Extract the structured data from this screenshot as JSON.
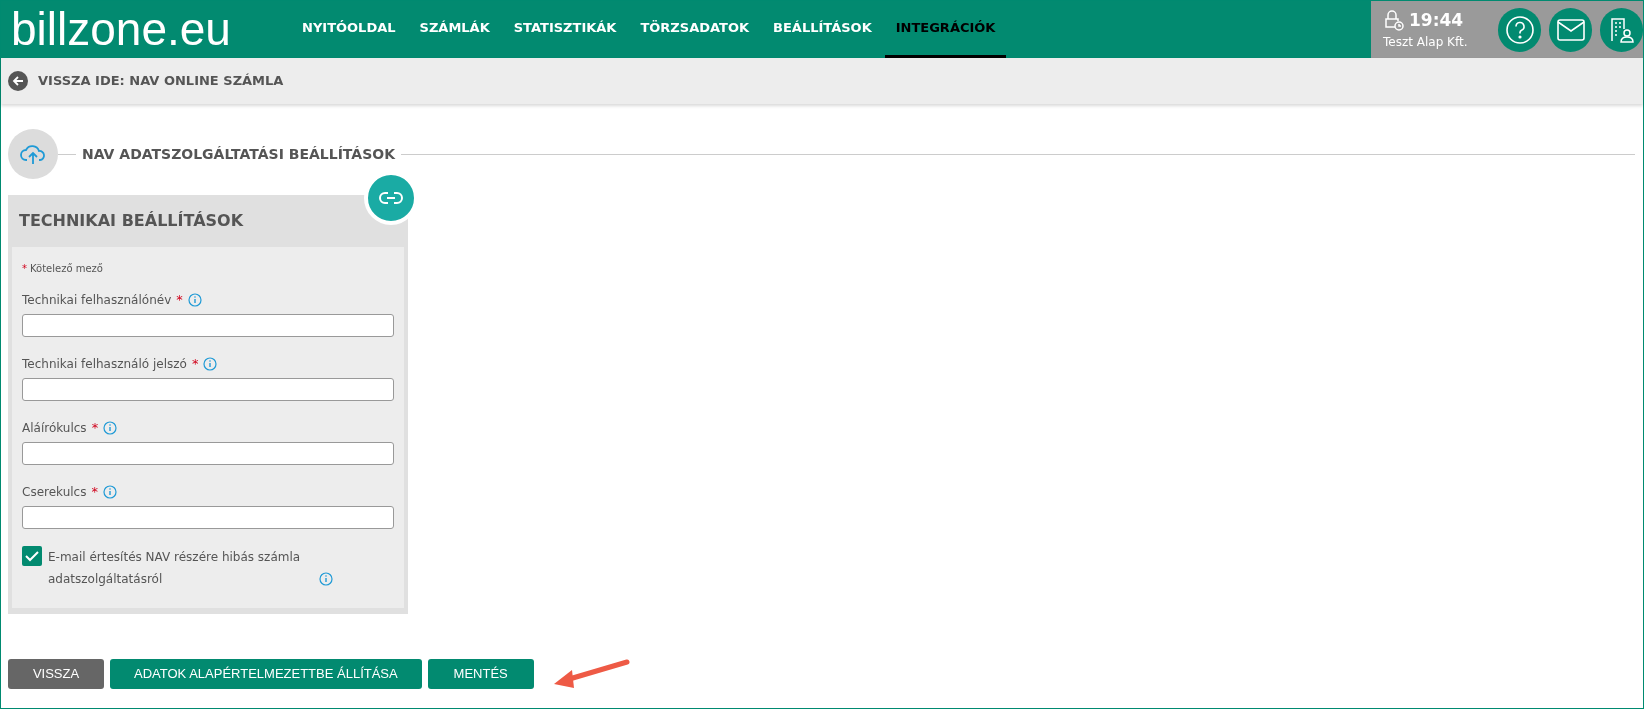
{
  "logo": "billzone.eu",
  "nav": [
    {
      "label": "NYITÓOLDAL",
      "selected": false
    },
    {
      "label": "SZÁMLÁK",
      "selected": false
    },
    {
      "label": "STATISZTIKÁK",
      "selected": false
    },
    {
      "label": "TÖRZSADATOK",
      "selected": false
    },
    {
      "label": "BEÁLLÍTÁSOK",
      "selected": false
    },
    {
      "label": "INTEGRÁCIÓK",
      "selected": true
    }
  ],
  "session": {
    "time": "19:44",
    "company": "Teszt Alap Kft."
  },
  "back_link": "VISSZA IDE: NAV ONLINE SZÁMLA",
  "section_title": "NAV ADATSZOLGÁLTATÁSI BEÁLLÍTÁSOK",
  "card": {
    "title": "TECHNIKAI BEÁLLÍTÁSOK",
    "required_mark": "*",
    "required_note": "Kötelező mező",
    "fields": [
      {
        "label": "Technikai felhasználónév",
        "required_mark": "*"
      },
      {
        "label": "Technikai felhasználó jelszó",
        "required_mark": "*"
      },
      {
        "label": "Aláírókulcs",
        "required_mark": "*"
      },
      {
        "label": "Cserekulcs",
        "required_mark": "*"
      }
    ],
    "checkbox": {
      "label": "E-mail értesítés NAV részére hibás számla adatszolgáltatásról",
      "checked": true
    }
  },
  "buttons": [
    {
      "label": "VISSZA",
      "kind": "secondary"
    },
    {
      "label": "ADATOK ALAPÉRTELMEZETTBE ÁLLÍTÁSA",
      "kind": "primary"
    },
    {
      "label": "MENTÉS",
      "kind": "primary"
    }
  ]
}
